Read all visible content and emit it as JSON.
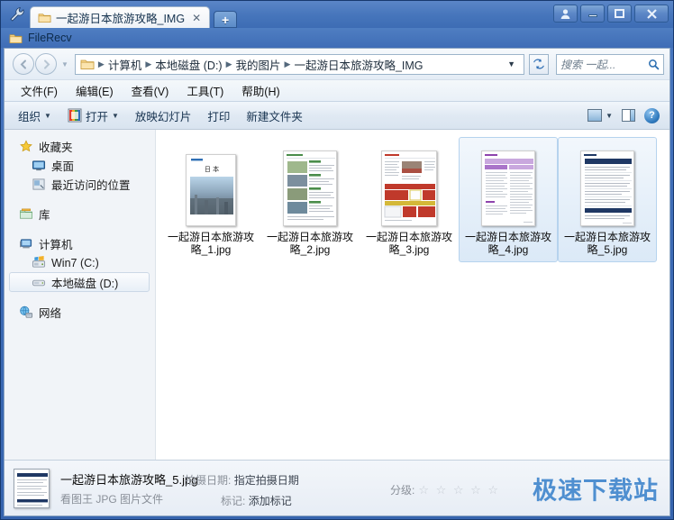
{
  "window": {
    "tab_title": "一起游日本旅游攻略_IMG",
    "tab_close": "✕",
    "new_tab": "+",
    "filerecv_label": "FileRecv",
    "buttons": {
      "user": "👤",
      "minimize": "—",
      "maximize": "❐",
      "close": "✕"
    }
  },
  "address": {
    "back": "◀",
    "forward": "▶",
    "history_caret": "▼",
    "crumbs": [
      "计算机",
      "本地磁盘 (D:)",
      "我的图片",
      "一起游日本旅游攻略_IMG"
    ],
    "separator": "▶",
    "dropdown_caret": "▼",
    "refresh": "↻",
    "search_placeholder": "搜索 一起...",
    "search_value": "",
    "search_icon": "⌕"
  },
  "menubar": {
    "items": [
      "文件(F)",
      "编辑(E)",
      "查看(V)",
      "工具(T)",
      "帮助(H)"
    ]
  },
  "commandbar": {
    "organize": "组织",
    "open": "打开",
    "slideshow": "放映幻灯片",
    "print": "打印",
    "new_folder": "新建文件夹",
    "caret": "▼",
    "help": "?"
  },
  "navpane": {
    "groups": [
      {
        "header": {
          "label": "收藏夹",
          "icon": "star-icon"
        },
        "items": [
          {
            "label": "桌面",
            "icon": "desktop-icon"
          },
          {
            "label": "最近访问的位置",
            "icon": "recent-places-icon"
          }
        ]
      },
      {
        "header": {
          "label": "库",
          "icon": "library-icon"
        },
        "items": []
      },
      {
        "header": {
          "label": "计算机",
          "icon": "computer-icon"
        },
        "items": [
          {
            "label": "Win7 (C:)",
            "icon": "windows-drive-icon",
            "selected": false
          },
          {
            "label": "本地磁盘 (D:)",
            "icon": "hard-drive-icon",
            "selected": true
          }
        ]
      },
      {
        "header": {
          "label": "网络",
          "icon": "network-icon"
        },
        "items": []
      }
    ]
  },
  "files": [
    {
      "name": "一起游日本旅游攻略_1.jpg",
      "selected": false,
      "thumb": "cover-japan"
    },
    {
      "name": "一起游日本旅游攻略_2.jpg",
      "selected": false,
      "thumb": "photo-list"
    },
    {
      "name": "一起游日本旅游攻略_3.jpg",
      "selected": false,
      "thumb": "red-table"
    },
    {
      "name": "一起游日本旅游攻略_4.jpg",
      "selected": true,
      "thumb": "purple-table"
    },
    {
      "name": "一起游日本旅游攻略_5.jpg",
      "selected": true,
      "thumb": "navy-table"
    }
  ],
  "details": {
    "file_name": "一起游日本旅游攻略_5.jpg",
    "file_type": "看图王 JPG 图片文件",
    "shoot_date_label": "拍摄日期:",
    "shoot_date_value": "指定拍摄日期",
    "tags_label": "标记:",
    "tags_value": "添加标记",
    "rating_label": "分级:",
    "rating_stars": "☆ ☆ ☆ ☆ ☆",
    "watermark": "极速下载站"
  },
  "colors": {
    "titlebar": "#4776bc",
    "accent": "#2a6db0",
    "selection": "#dbe9f7",
    "watermark": "#4f8fd0"
  }
}
